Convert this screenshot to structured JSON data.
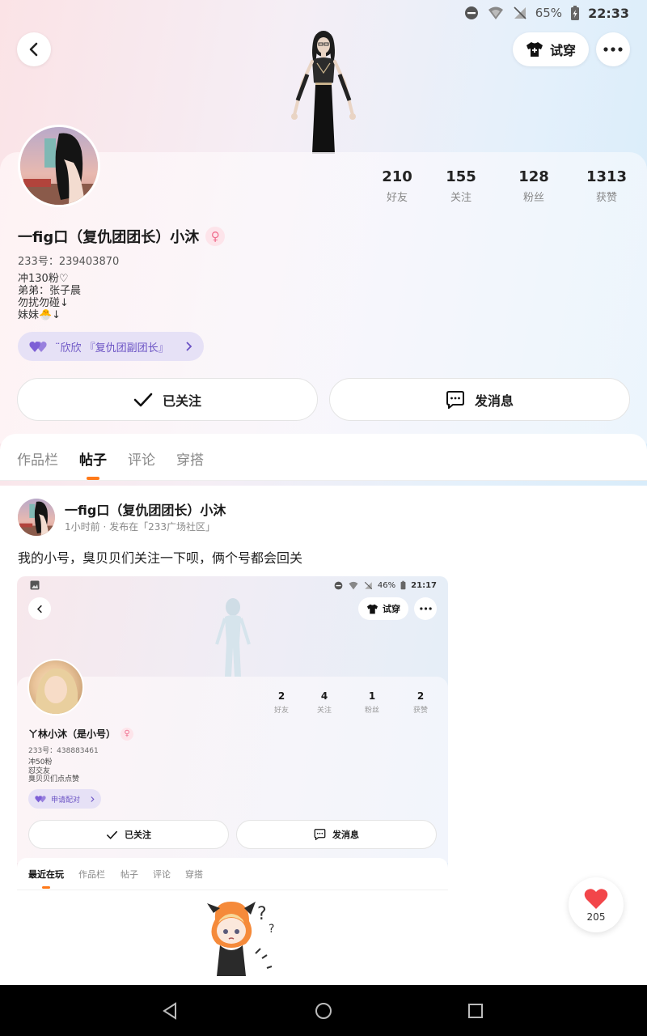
{
  "status_bar": {
    "battery": "65%",
    "time": "22:33"
  },
  "header": {
    "try_on_label": "试穿"
  },
  "profile": {
    "stats": [
      {
        "num": "210",
        "label": "好友"
      },
      {
        "num": "155",
        "label": "关注"
      },
      {
        "num": "128",
        "label": "粉丝"
      },
      {
        "num": "1313",
        "label": "获赞"
      }
    ],
    "name": "一fig口（复仇团团长）小沐",
    "gender_symbol": "♀",
    "id_line": "233号：239403870",
    "bio": "冲130粉♡\n弟弟：张子晨\n勿扰勿碰↓\n妹妹🐣↓",
    "bff_label": "¨欣欣 『复仇团副团长』",
    "follow_label": "已关注",
    "message_label": "发消息"
  },
  "tabs": [
    {
      "label": "作品栏"
    },
    {
      "label": "帖子"
    },
    {
      "label": "评论"
    },
    {
      "label": "穿搭"
    }
  ],
  "post": {
    "author": "一fig口（复仇团团长）小沐",
    "meta": "1小时前 · 发布在「233广场社区」",
    "text": "我的小号，臭贝贝们关注一下呗，俩个号都会回关",
    "like_count": "205"
  },
  "embedded": {
    "battery": "46%",
    "time": "21:17",
    "try_on_label": "试穿",
    "stats": [
      {
        "num": "2",
        "label": "好友"
      },
      {
        "num": "4",
        "label": "关注"
      },
      {
        "num": "1",
        "label": "粉丝"
      },
      {
        "num": "2",
        "label": "获赞"
      }
    ],
    "name": "ㄚ林小沐（是小号）",
    "gender_symbol": "♀",
    "id_line": "233号：438883461",
    "bio": "冲50粉\n怼交友\n臭贝贝们点点赞",
    "pair_label": "申请配对",
    "follow_label": "已关注",
    "message_label": "发消息",
    "tabs": [
      {
        "label": "最近在玩"
      },
      {
        "label": "作品栏"
      },
      {
        "label": "帖子"
      },
      {
        "label": "评论"
      },
      {
        "label": "穿搭"
      }
    ]
  },
  "colors": {
    "accent": "#ff7a1a",
    "like": "#f2464a",
    "bff_bg": "#e6e1f6",
    "bff_text": "#6a52c4"
  }
}
